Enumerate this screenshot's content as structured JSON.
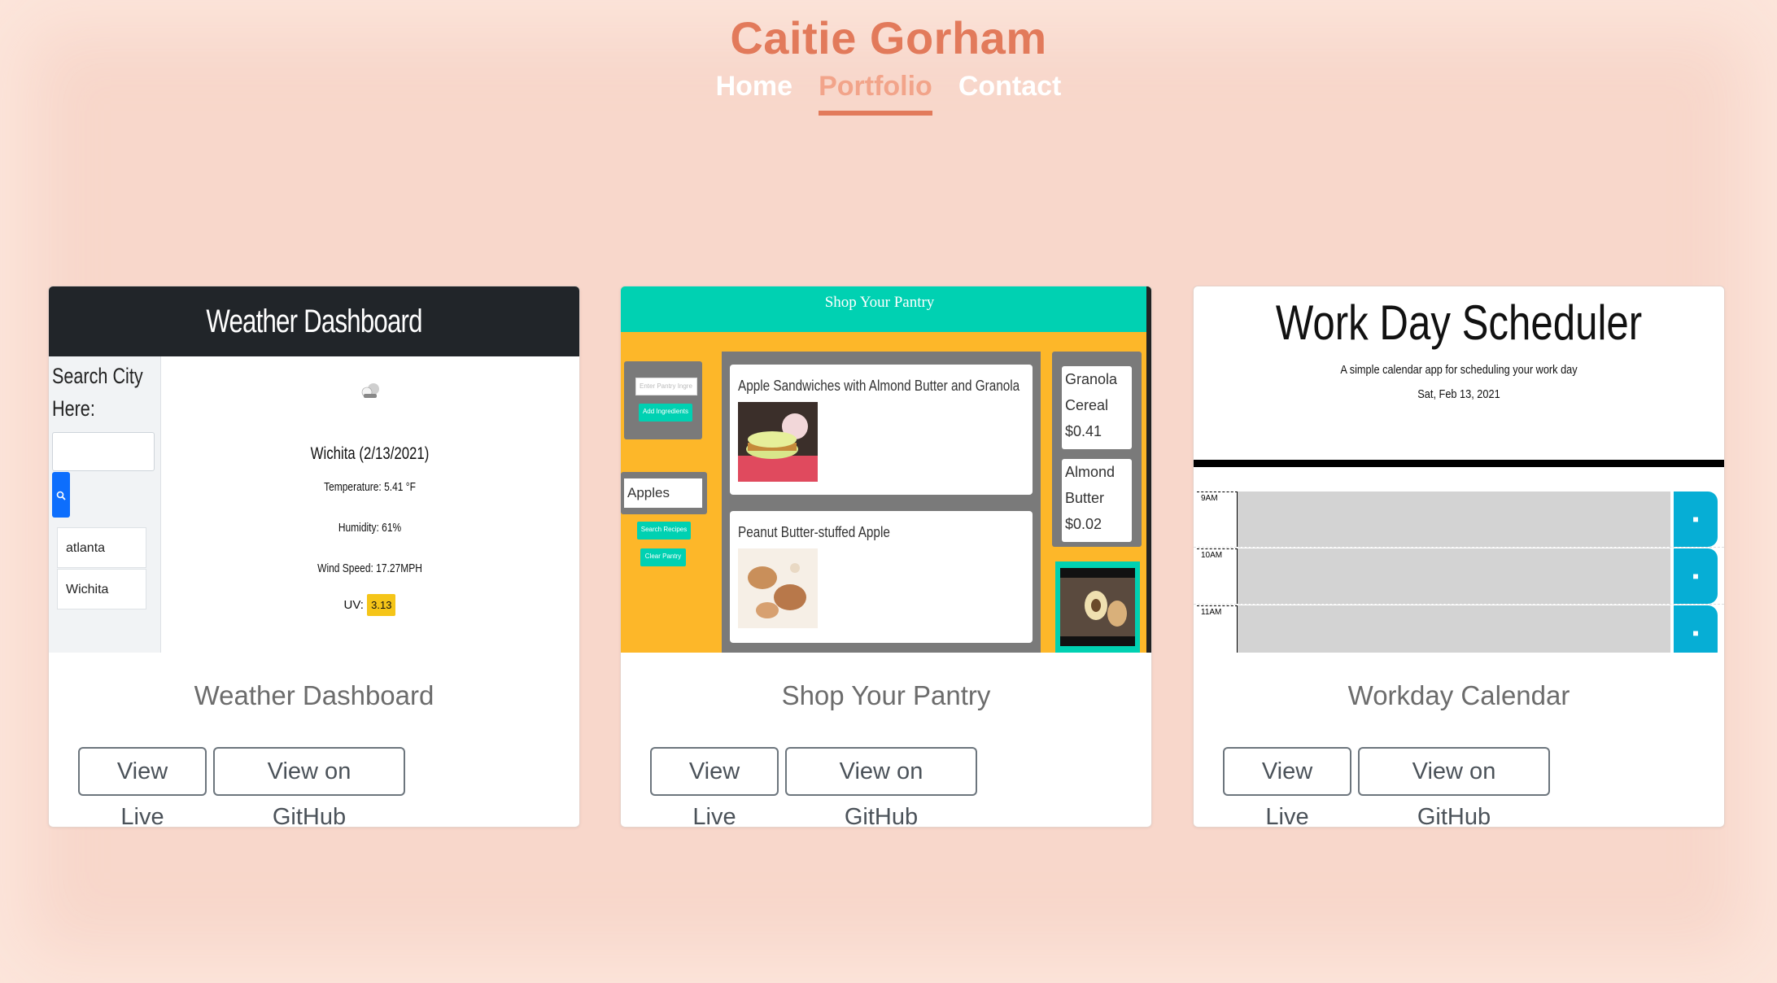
{
  "site": {
    "title": "Caitie Gorham",
    "nav": [
      {
        "label": "Home",
        "active": false
      },
      {
        "label": "Portfolio",
        "active": true
      },
      {
        "label": "Contact",
        "active": false
      }
    ]
  },
  "colors": {
    "background": "#f8d7cb",
    "accent": "#e27a5b",
    "nav_text": "#ffffff"
  },
  "projects": [
    {
      "title": "Weather Dashboard",
      "view_live_label": "View Live",
      "github_label": "View on GitHub",
      "preview": {
        "header": "Weather Dashboard",
        "search_label": "Search City Here:",
        "search_icon": "search-icon",
        "history": [
          "atlanta",
          "Wichita"
        ],
        "city": "Wichita (2/13/2021)",
        "temperature": "Temperature: 5.41 °F",
        "humidity": "Humidity: 61%",
        "wind": "Wind Speed: 17.27MPH",
        "uv_label": "UV:",
        "uv_value": "3.13"
      }
    },
    {
      "title": "Shop Your Pantry",
      "view_live_label": "View Live",
      "github_label": "View on GitHub",
      "preview": {
        "header": "Shop Your Pantry",
        "input_placeholder": "Enter Pantry Ingre",
        "add_btn": "Add Ingredients",
        "ingredient": "Apples",
        "search_btn": "Search Recipes",
        "clear_btn": "Clear Pantry",
        "recipes": [
          "Apple Sandwiches with Almond Butter and Granola",
          "Peanut Butter-stuffed Apple"
        ],
        "products": [
          {
            "name1": "Granola",
            "name2": "Cereal",
            "price": "$0.41"
          },
          {
            "name1": "Almond",
            "name2": "Butter",
            "price": "$0.02"
          }
        ]
      }
    },
    {
      "title": "Workday Calendar",
      "view_live_label": "View Live",
      "github_label": "View on GitHub",
      "preview": {
        "header": "Work Day Scheduler",
        "subtitle": "A simple calendar app for scheduling your work day",
        "date": "Sat, Feb 13, 2021",
        "hours": [
          "9AM",
          "10AM",
          "11AM"
        ],
        "save_icon": "lock-icon"
      }
    }
  ]
}
